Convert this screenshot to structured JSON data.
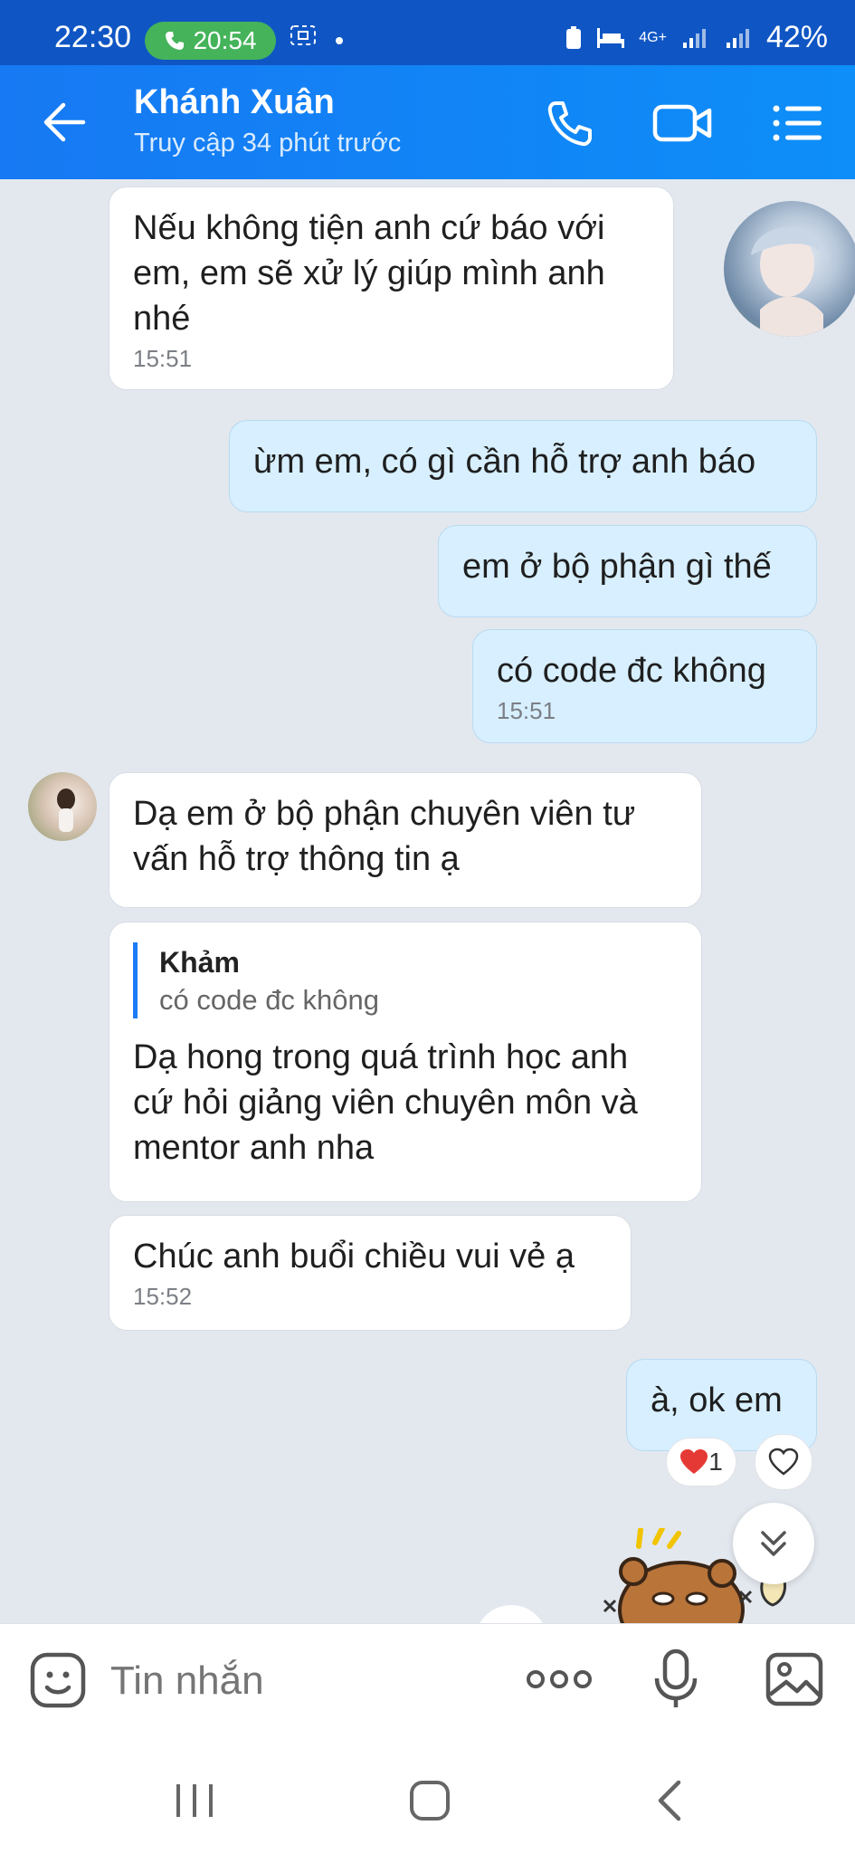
{
  "status_bar": {
    "time": "22:30",
    "call_timer": "20:54",
    "network": "4G+",
    "battery": "42%"
  },
  "header": {
    "contact_name": "Khánh Xuân",
    "last_seen": "Truy cập 34 phút trước",
    "icons": [
      "back-arrow-icon",
      "phone-icon",
      "video-call-icon",
      "menu-list-icon"
    ]
  },
  "messages": [
    {
      "side": "in",
      "text": "Nếu không tiện anh cứ báo với em, em sẽ xử lý giúp mình anh nhé",
      "time": "15:51"
    },
    {
      "side": "out",
      "text": "ừm em, có gì cần hỗ trợ anh báo"
    },
    {
      "side": "out",
      "text": "em ở bộ phận gì thế"
    },
    {
      "side": "out",
      "text": "có code đc không",
      "time": "15:51"
    },
    {
      "side": "in",
      "text": "Dạ em ở bộ phận chuyên viên tư vấn hỗ trợ thông tin ạ"
    },
    {
      "side": "in",
      "quote_name": "Khảm",
      "quote_text": "có code đc không",
      "text": "Dạ hong trong quá trình học anh cứ hỏi giảng viên chuyên môn và mentor anh nha"
    },
    {
      "side": "in",
      "text": "Chúc anh buổi chiều vui vẻ ạ",
      "time": "15:52"
    },
    {
      "side": "out",
      "text": "à, ok em",
      "reaction_count": "1"
    }
  ],
  "input": {
    "placeholder": "Tin nhắn"
  },
  "colors": {
    "header": "#1779f3",
    "status_bar": "#0f56c4",
    "chat_bg": "#e3e8ef",
    "outgoing_bubble": "#d7efff",
    "incoming_bubble": "#ffffff",
    "accent": "#1c7cf4"
  }
}
